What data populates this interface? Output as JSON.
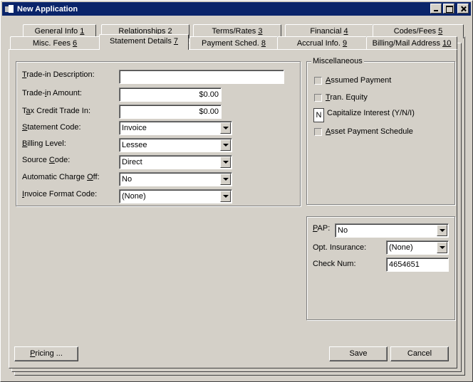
{
  "window": {
    "title": "New Application"
  },
  "tabs_back": [
    {
      "pre": "General Info ",
      "key": "1",
      "post": ""
    },
    {
      "pre": "Relationships ",
      "key": "2",
      "post": ""
    },
    {
      "pre": "Terms/Rates ",
      "key": "3",
      "post": ""
    },
    {
      "pre": "Financial ",
      "key": "4",
      "post": ""
    },
    {
      "pre": "Codes/Fees ",
      "key": "5",
      "post": ""
    }
  ],
  "tabs_front": [
    {
      "pre": "Misc. Fees ",
      "key": "6",
      "post": ""
    },
    {
      "pre": "Statement Details ",
      "key": "7",
      "post": ""
    },
    {
      "pre": "Payment Sched. ",
      "key": "8",
      "post": ""
    },
    {
      "pre": "Accrual Info. ",
      "key": "9",
      "post": ""
    },
    {
      "pre": "Billing/Mail Address ",
      "key": "10",
      "post": ""
    }
  ],
  "form": {
    "tradein_desc": {
      "label_key": "T",
      "label_rest": "rade-in Description:",
      "value": ""
    },
    "tradein_amount": {
      "label_pre": "Trade-",
      "label_key": "i",
      "label_rest": "n Amount:",
      "value": "$0.00"
    },
    "tax_credit": {
      "label_pre": "T",
      "label_key": "a",
      "label_rest": "x Credit Trade In:",
      "value": "$0.00"
    },
    "statement_code": {
      "label_pre": "",
      "label_key": "S",
      "label_rest": "tatement Code:",
      "value": "Invoice"
    },
    "billing_level": {
      "label_key": "B",
      "label_rest": "illing Level:",
      "value": "Lessee"
    },
    "source_code": {
      "label_pre": "Source ",
      "label_key": "C",
      "label_rest": "ode:",
      "value": "Direct"
    },
    "auto_charge_off": {
      "label_pre": "Automatic Charge ",
      "label_key": "O",
      "label_rest": "ff:",
      "value": "No"
    },
    "invoice_format": {
      "label_key": "I",
      "label_rest": "nvoice Format Code:",
      "value": "(None)"
    }
  },
  "misc": {
    "legend": "Miscellaneous",
    "assumed_payment": {
      "key": "A",
      "rest": "ssumed Payment"
    },
    "tran_equity": {
      "key": "T",
      "rest": "ran. Equity"
    },
    "capitalize_value": "N",
    "capitalize_label": "Capitalize Interest (Y/N/I)",
    "asset_schedule": {
      "key": "A",
      "rest": "sset Payment Schedule"
    }
  },
  "pap": {
    "pap": {
      "key": "P",
      "rest": "AP:",
      "value": "No"
    },
    "opt_insurance": {
      "label": "Opt. Insurance:",
      "value": "(None)"
    },
    "check_num": {
      "label": "Check Num:",
      "value": "4654651"
    }
  },
  "buttons": {
    "pricing": {
      "key": "P",
      "rest": "ricing ..."
    },
    "save": "Save",
    "cancel": "Cancel"
  }
}
